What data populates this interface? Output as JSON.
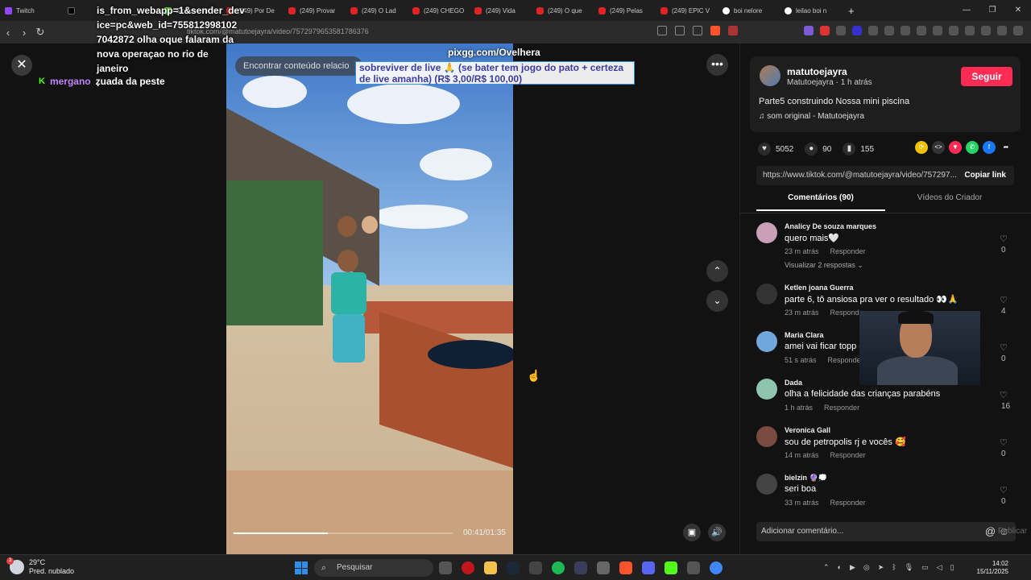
{
  "browser": {
    "tabs": [
      {
        "label": "Twitch",
        "icon": "twitch-icon"
      },
      {
        "label": "",
        "icon": "tiktok-icon"
      },
      {
        "label": "Stream - Ki",
        "icon": "kick-icon"
      },
      {
        "label": "(249) Por De",
        "icon": "youtube-icon"
      },
      {
        "label": "(249) Provar",
        "icon": "youtube-icon"
      },
      {
        "label": "(249) O Lad",
        "icon": "youtube-icon"
      },
      {
        "label": "(249) CHEGO",
        "icon": "youtube-icon"
      },
      {
        "label": "(249) Vida",
        "icon": "youtube-icon"
      },
      {
        "label": "(249) O que",
        "icon": "youtube-icon"
      },
      {
        "label": "(249) Pelas",
        "icon": "youtube-icon"
      },
      {
        "label": "(249) EPIC V",
        "icon": "youtube-icon"
      },
      {
        "label": "boi nelore",
        "icon": "google-icon"
      },
      {
        "label": "leilao boi n",
        "icon": "google-icon"
      }
    ],
    "new_tab": "+",
    "url": "tiktok.com/@matutoejayra/video/7572979653581786376"
  },
  "overlay": {
    "chat_lines": [
      "is_from_webapp=1&sender_dev",
      "ice=pc&web_id=755812998102",
      "7042872 olha oque falaram da",
      "nova operaçao no rio de janeiro",
      "."
    ],
    "chat_user": "mergano",
    "chat_message": "zuada da peste",
    "pix": "pixgg.com/Ovelhera",
    "live_banner": "sobreviver de live 🙏 (se bater tem jogo do pato + certeza de live amanha) (R$ 3,00/R$ 100,00)",
    "search_placeholder": "Encontrar conteúdo relacio"
  },
  "video": {
    "current_time": "00:41/01:35",
    "progress": 0.43
  },
  "panel": {
    "author": "matutoejayra",
    "author_sub": "Matutoejayra · 1 h atrás",
    "follow": "Seguir",
    "description": "Parte5 construindo Nossa mini piscina",
    "music": "som original - Matutoejayra",
    "likes": "5052",
    "comments": "90",
    "saves": "155",
    "link": "https://www.tiktok.com/@matutoejayra/video/757297...",
    "copy_link": "Copiar link",
    "tab_comments": "Comentários (90)",
    "tab_creator": "Vídeos do Criador",
    "reply_label": "Responder",
    "comment_list": [
      {
        "name": "Analicy De souza marques",
        "text": "quero mais🤍",
        "time": "23 m atrás",
        "likes": "0",
        "replies": "Visualizar 2 respostas ⌄",
        "avatar_color": "#c9a0b8"
      },
      {
        "name": "Ketlen joana Guerra",
        "text": "parte 6, tô ansiosa pra ver o resultado 👀🙏",
        "time": "23 m atrás",
        "likes": "4",
        "replies": "",
        "avatar_color": "#333333"
      },
      {
        "name": "Maria Clara",
        "text": "amei vai ficar topp eee",
        "time": "51 s atrás",
        "likes": "0",
        "replies": "",
        "avatar_color": "#6fa8dc"
      },
      {
        "name": "Dada",
        "text": "olha a felicidade das crianças parabéns",
        "time": "1 h atrás",
        "likes": "16",
        "replies": "",
        "avatar_color": "#8fc4b0"
      },
      {
        "name": "Veronica Gall",
        "text": "sou de petropolis rj e vocês 🥰",
        "time": "14 m atrás",
        "likes": "0",
        "replies": "",
        "avatar_color": "#7a4a40"
      },
      {
        "name": "bielzin 🔮💭",
        "text": "seri boa",
        "time": "33 m atrás",
        "likes": "0",
        "replies": "",
        "avatar_color": "#444444"
      }
    ],
    "composer_placeholder": "Adicionar comentário...",
    "publish": "Publicar"
  },
  "taskbar": {
    "temp": "29°C",
    "weather": "Pred. nublado",
    "weather_badge": "3",
    "search": "Pesquisar",
    "time": "14:02",
    "date": "15/11/2025"
  },
  "colors": {
    "follow": "#fe2c55",
    "chat_user": "#c084fc",
    "kick_green": "#53fc18"
  }
}
